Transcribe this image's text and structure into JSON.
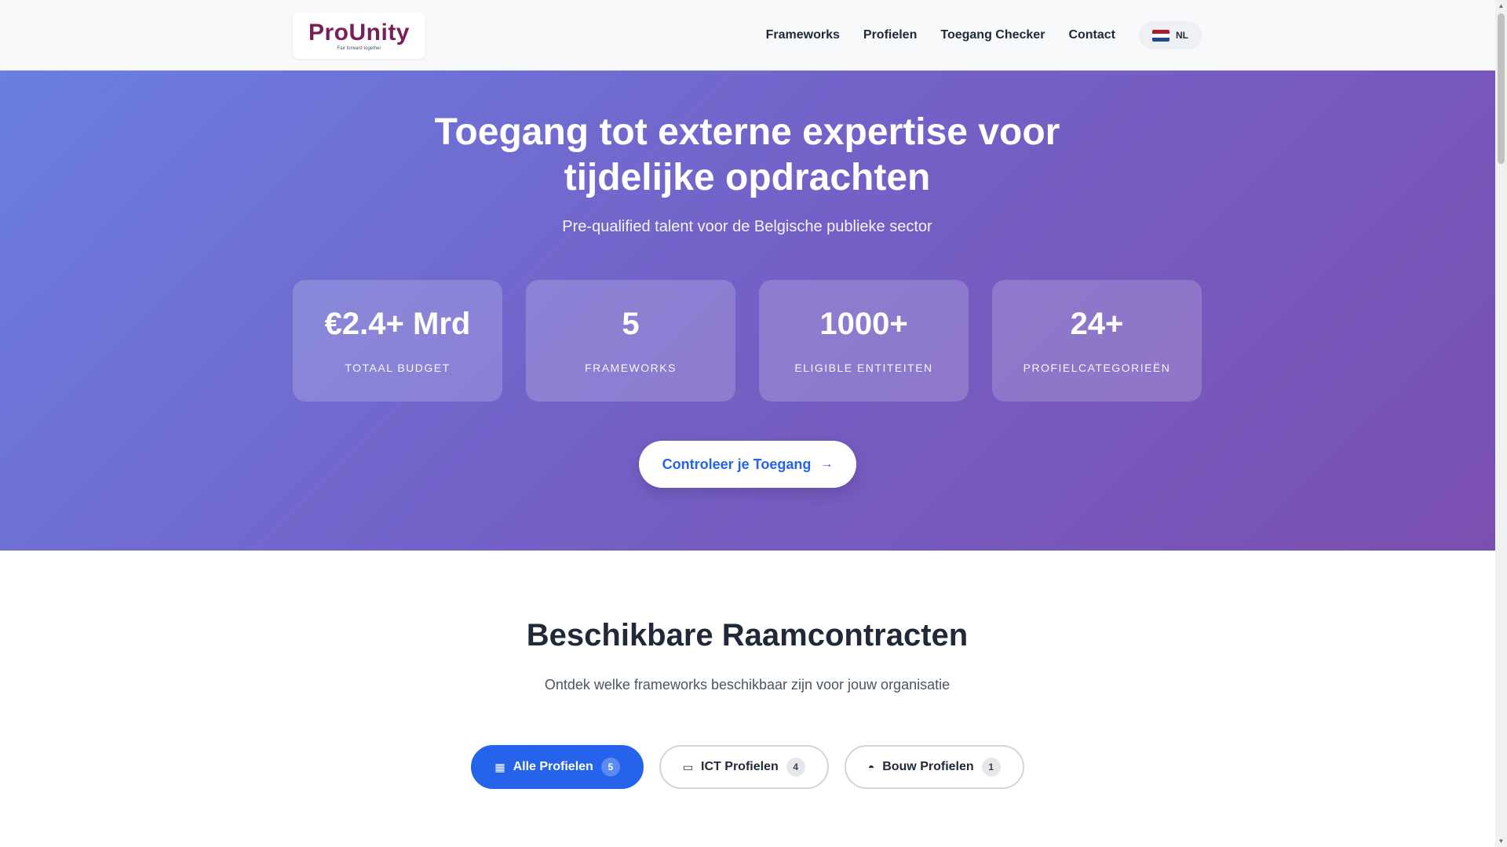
{
  "header": {
    "logo": {
      "word": "ProUnity",
      "tagline": "Fair forward together"
    },
    "nav": [
      "Frameworks",
      "Profielen",
      "Toegang Checker",
      "Contact"
    ],
    "language": {
      "label": "NL",
      "flag_colors": [
        "#ae1c28",
        "#ffffff",
        "#21468b"
      ]
    }
  },
  "hero": {
    "title": "Toegang tot externe expertise voor tijdelijke opdrachten",
    "subtitle": "Pre-qualified talent voor de Belgische publieke sector",
    "stats": [
      {
        "value": "€2.4+ Mrd",
        "label": "TOTAAL BUDGET"
      },
      {
        "value": "5",
        "label": "FRAMEWORKS"
      },
      {
        "value": "1000+",
        "label": "ELIGIBLE ENTITEITEN"
      },
      {
        "value": "24+",
        "label": "PROFIELCATEGORIEËN"
      }
    ],
    "cta": {
      "label": "Controleer je Toegang",
      "icon": "arrow-right-icon"
    }
  },
  "section": {
    "title": "Beschikbare Raamcontracten",
    "subtitle": "Ontdek welke frameworks beschikbaar zijn voor jouw organisatie",
    "filters": [
      {
        "label": "Alle Profielen",
        "count": "5",
        "icon": "grid-icon",
        "active": true
      },
      {
        "label": "ICT Profielen",
        "count": "4",
        "icon": "laptop-icon",
        "active": false
      },
      {
        "label": "Bouw Profielen",
        "count": "1",
        "icon": "hardhat-icon",
        "active": false
      }
    ]
  },
  "colors": {
    "accent": "#2563eb",
    "brand": "#7a1e5a",
    "hero_gradient_start": "#6a7fe0",
    "hero_gradient_end": "#7a4fb0"
  }
}
